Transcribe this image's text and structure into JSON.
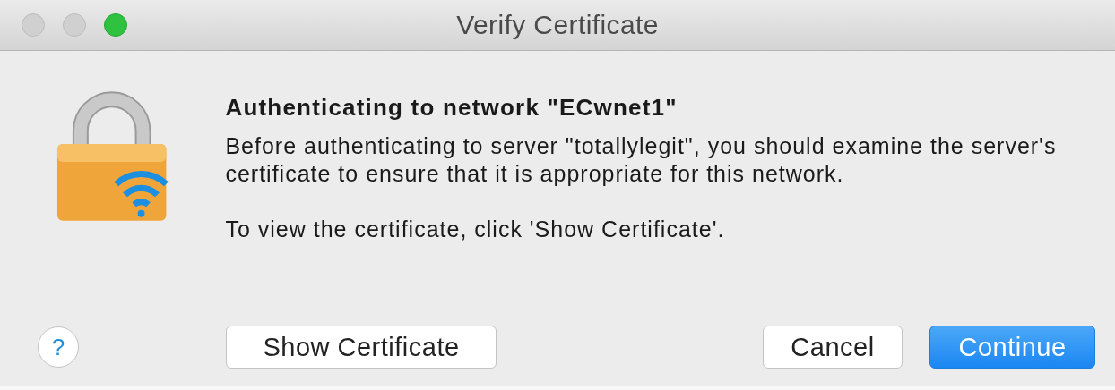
{
  "window": {
    "title": "Verify Certificate"
  },
  "heading": "Authenticating to network \"ECwnet1\"",
  "paragraphs": [
    "Before authenticating to server \"totallylegit\", you should examine the server's certificate to ensure that it is appropriate for this network.",
    "To view the certificate, click 'Show Certificate'."
  ],
  "help_button": {
    "label": "?"
  },
  "buttons": [
    {
      "label": "Show Certificate",
      "kind": "normal"
    },
    {
      "label": "Cancel",
      "kind": "normal"
    },
    {
      "label": "Continue",
      "kind": "default"
    }
  ]
}
